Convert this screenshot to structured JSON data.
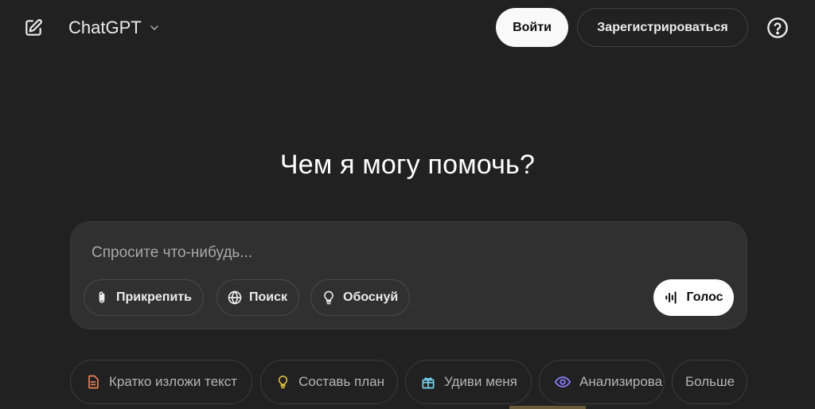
{
  "header": {
    "model_name": "ChatGPT",
    "login_label": "Войти",
    "signup_label": "Зарегистрироваться",
    "icons": {
      "edit": "edit-icon",
      "chevron": "chevron-down-icon",
      "help": "help-icon"
    }
  },
  "main": {
    "heading": "Чем я могу помочь?"
  },
  "composer": {
    "placeholder": "Спросите что-нибудь...",
    "tools": [
      {
        "label": "Прикрепить",
        "icon": "paperclip-icon"
      },
      {
        "label": "Поиск",
        "icon": "globe-icon"
      },
      {
        "label": "Обоснуй",
        "icon": "lightbulb-icon"
      }
    ],
    "voice_label": "Голос",
    "voice_icon": "waveform-icon"
  },
  "suggestions": [
    {
      "label": "Кратко изложи текст",
      "icon": "document-icon",
      "color": "#e8825a"
    },
    {
      "label": "Составь план",
      "icon": "lightbulb-icon",
      "color": "#e2c541"
    },
    {
      "label": "Удиви меня",
      "icon": "gift-icon",
      "color": "#76d0eb"
    },
    {
      "label": "Анализирова",
      "icon": "eye-icon",
      "color": "#8b7cf6"
    },
    {
      "label": "Больше",
      "icon": "",
      "color": ""
    }
  ],
  "colors": {
    "background": "#212121",
    "composer": "#303030",
    "primary_button": "#f9f9f9"
  }
}
